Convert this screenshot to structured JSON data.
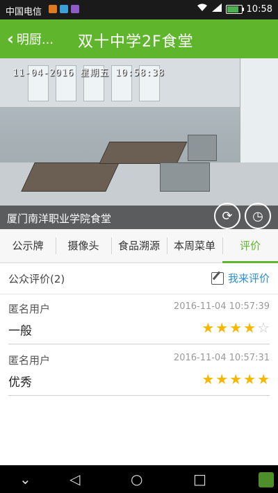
{
  "status_bar": {
    "carrier": "中国电信",
    "app_icon_colors": [
      "#e07a1f",
      "#3aa0d8",
      "#8e5bc7"
    ],
    "time": "10:58",
    "battery_level": 0.85
  },
  "app_bar": {
    "back_label": "明厨...",
    "title": "双十中学2F食堂"
  },
  "camera": {
    "timestamp": "11-04-2016 星期五 10:58:38",
    "caption": "厦门南洋职业学院食堂",
    "refresh_icon": "⟳",
    "timer_icon": "◷"
  },
  "tabs": [
    {
      "label": "公示牌",
      "active": false
    },
    {
      "label": "摄像头",
      "active": false
    },
    {
      "label": "食品溯源",
      "active": false
    },
    {
      "label": "本周菜单",
      "active": false
    },
    {
      "label": "评价",
      "active": true
    }
  ],
  "reviews_section": {
    "title": "公众评价(2)",
    "write_label": "我来评价"
  },
  "reviews": [
    {
      "user": "匿名用户",
      "time": "2016-11-04 10:57:39",
      "text": "一般",
      "rating": 4,
      "max": 5
    },
    {
      "user": "匿名用户",
      "time": "2016-11-04 10:57:31",
      "text": "优秀",
      "rating": 5,
      "max": 5
    }
  ],
  "nav_bar": {
    "back": "⌄",
    "triangle": "◁",
    "home": "○",
    "recent": "□"
  },
  "colors": {
    "brand_green": "#5fb52c",
    "link_blue": "#2f8fd0",
    "star": "#f5b800"
  }
}
